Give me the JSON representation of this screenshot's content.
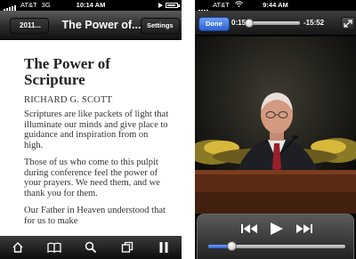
{
  "left_screen": {
    "status_bar": {
      "carrier": "AT&T",
      "network": "3G",
      "time": "10:14 AM"
    },
    "nav": {
      "back_label": "2011...",
      "title": "The Power of...",
      "settings_label": "Settings"
    },
    "article": {
      "title": "The Power of Scripture",
      "author": "RICHARD G. SCOTT",
      "paragraphs": [
        "Scriptures are like packets of light that illuminate our minds and give place to guidance and inspiration from on high.",
        "Those of us who come to this pulpit during conference feel the power of your prayers. We need them, and we thank you for them.",
        "Our Father in Heaven understood that for us to make"
      ]
    },
    "toolbar": {
      "icons": [
        "home-icon",
        "book-icon",
        "search-icon",
        "pages-icon",
        "pause-icon"
      ]
    }
  },
  "right_screen": {
    "status_bar": {
      "carrier": "AT&T",
      "time": "9:44 AM"
    },
    "player": {
      "done_label": "Done",
      "elapsed": "0:15",
      "remaining": "-15:52",
      "progress_fraction": 0.016,
      "volume_fraction": 0.17
    },
    "controls": {
      "icons": [
        "rewind-icon",
        "play-icon",
        "fast-forward-icon"
      ]
    },
    "colors": {
      "done_button": "#2d63d6",
      "volume_fill": "#2b5fd8",
      "podium": "#5a2a14",
      "flowers": "#d8b83a"
    }
  }
}
